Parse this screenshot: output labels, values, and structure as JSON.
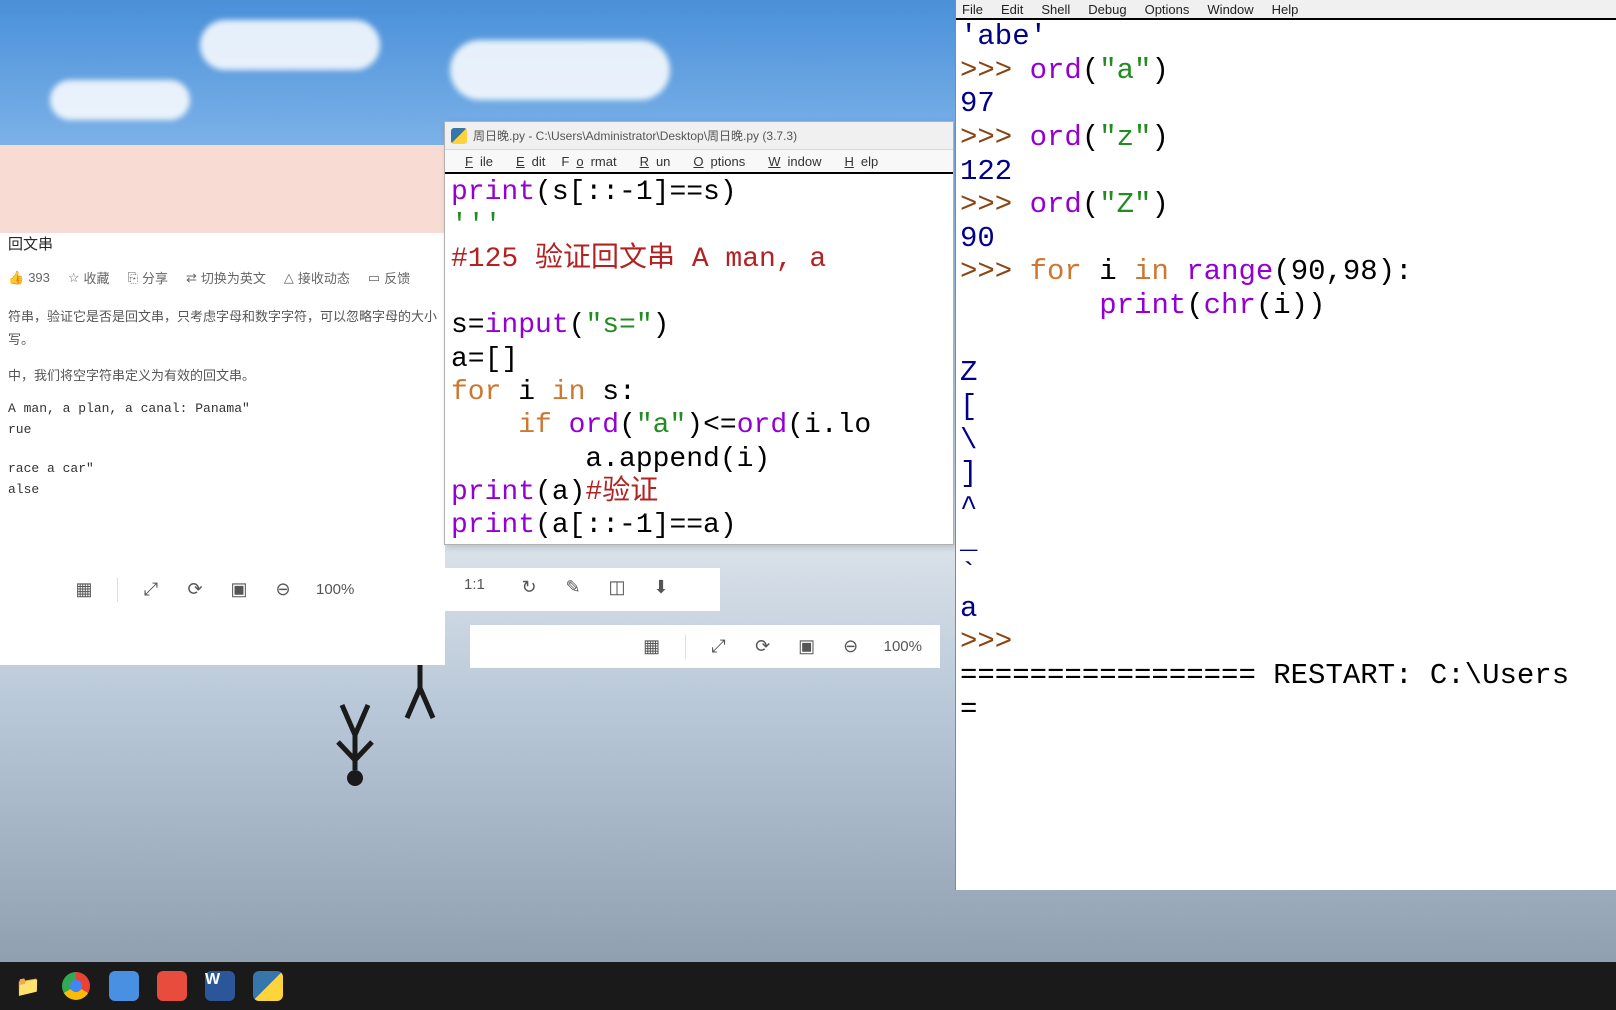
{
  "browser": {
    "title": "回文串",
    "actions": {
      "like": "393",
      "collect": "收藏",
      "share": "分享",
      "switch": "切换为英文",
      "receive": "接收动态",
      "feedback": "反馈"
    },
    "desc1": "符串，验证它是否是回文串，只考虑字母和数字字符，可以忽略字母的大小写。",
    "desc2": "中，我们将空字符串定义为有效的回文串。",
    "example1_in": "A man, a plan, a canal: Panama\"",
    "example1_out": "rue",
    "example2_in": "race a car\"",
    "example2_out": "alse",
    "zoom": "100%",
    "scale": "1:1"
  },
  "editor": {
    "title": "周日晚.py - C:\\Users\\Administrator\\Desktop\\周日晚.py (3.7.3)",
    "menu": [
      "File",
      "Edit",
      "Format",
      "Run",
      "Options",
      "Window",
      "Help"
    ],
    "code": {
      "l1a": "print",
      "l1b": "(s[::-1]==s)",
      "l2": "'''",
      "l3": "#125 验证回文串 A man, a ",
      "l4a": "s=",
      "l4b": "input",
      "l4c": "(",
      "l4d": "\"s=\"",
      "l4e": ")",
      "l5": "a=[]",
      "l6a": "for",
      "l6b": " i ",
      "l6c": "in",
      "l6d": " s:",
      "l7a": "    if",
      "l7b": " ",
      "l7c": "ord",
      "l7d": "(",
      "l7e": "\"a\"",
      "l7f": ")<=",
      "l7g": "ord",
      "l7h": "(i.lo",
      "l8a": "        a.append(i)",
      "l9a": "print",
      "l9b": "(a)",
      "l9c": "#验证",
      "l10a": "print",
      "l10b": "(a[::-1]==a)"
    }
  },
  "shell": {
    "menu": [
      "File",
      "Edit",
      "Shell",
      "Debug",
      "Options",
      "Window",
      "Help"
    ],
    "lines": {
      "l0": "'abe'",
      "p1": ">>> ",
      "l1a": "ord",
      "l1b": "(",
      "l1c": "\"a\"",
      "l1d": ")",
      "r1": "97",
      "p2": ">>> ",
      "l2a": "ord",
      "l2b": "(",
      "l2c": "\"z\"",
      "l2d": ")",
      "r2": "122",
      "p3": ">>> ",
      "l3a": "ord",
      "l3b": "(",
      "l3c": "\"Z\"",
      "l3d": ")",
      "r3": "90",
      "p4": ">>> ",
      "l4a": "for",
      "l4b": " i ",
      "l4c": "in",
      "l4d": " ",
      "l4e": "range",
      "l4f": "(90,98):",
      "l5a": "        ",
      "l5b": "print",
      "l5c": "(",
      "l5d": "chr",
      "l5e": "(i))",
      "out": "Z\n[\n\\\n]\n^\n_\n`\na",
      "p6": ">>> ",
      "restart": "================= RESTART: C:\\Users",
      "eq": "="
    }
  },
  "toolbar2": {
    "zoom": "100%"
  },
  "taskbar": {
    "items": [
      "file-explorer",
      "chrome",
      "app-blue",
      "app-red",
      "word",
      "python"
    ]
  }
}
